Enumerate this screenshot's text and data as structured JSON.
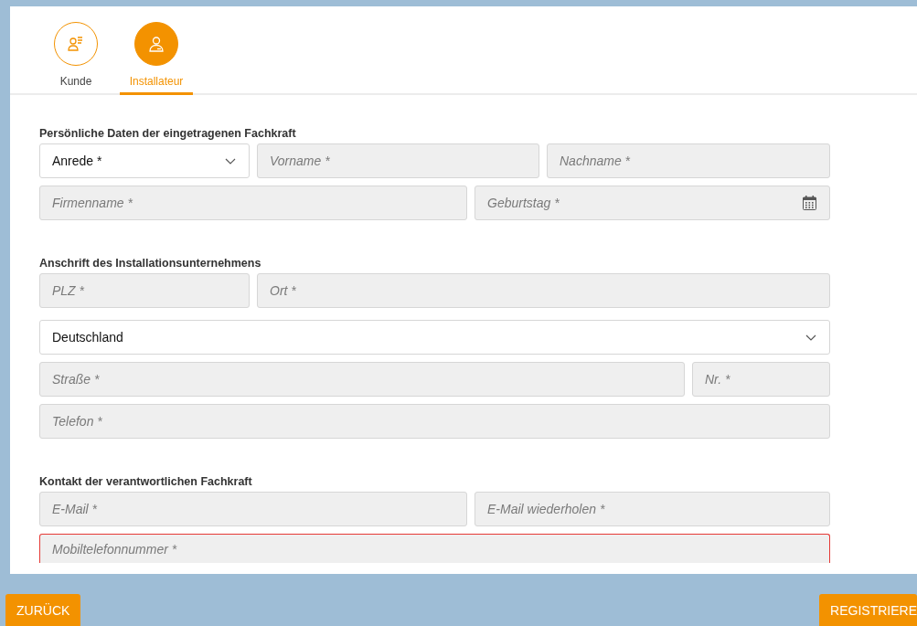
{
  "steps": [
    {
      "label": "Kunde",
      "selected": false
    },
    {
      "label": "Installateur",
      "selected": true
    }
  ],
  "sections": [
    {
      "title": "Persönliche Daten der eingetragenen Fachkraft",
      "rows": [
        [
          {
            "kind": "select",
            "value": "Anrede *"
          },
          {
            "kind": "text",
            "placeholder": "Vorname *"
          },
          {
            "kind": "text",
            "placeholder": "Nachname *"
          }
        ],
        [
          {
            "kind": "text",
            "placeholder": "Firmenname *"
          },
          {
            "kind": "date",
            "placeholder": "Geburtstag *"
          }
        ]
      ]
    },
    {
      "title": "Anschrift des Installationsunternehmens",
      "rows": [
        [
          {
            "kind": "text",
            "placeholder": "PLZ *"
          },
          {
            "kind": "text",
            "placeholder": "Ort *"
          }
        ],
        [
          {
            "kind": "select",
            "value": "Deutschland"
          }
        ],
        [
          {
            "kind": "text",
            "placeholder": "Straße *"
          },
          {
            "kind": "text",
            "placeholder": "Nr. *"
          }
        ],
        [
          {
            "kind": "text",
            "placeholder": "Telefon *"
          }
        ]
      ]
    },
    {
      "title": "Kontakt der verantwortlichen Fachkraft",
      "rows": [
        [
          {
            "kind": "text",
            "placeholder": "E-Mail *"
          },
          {
            "kind": "text",
            "placeholder": "E-Mail wiederholen *"
          }
        ],
        [
          {
            "kind": "text",
            "placeholder": "Mobiltelefonnummer *",
            "error": true
          }
        ]
      ]
    }
  ],
  "buttons": {
    "back": "ZURÜCK",
    "next": "REGISTRIERE"
  }
}
